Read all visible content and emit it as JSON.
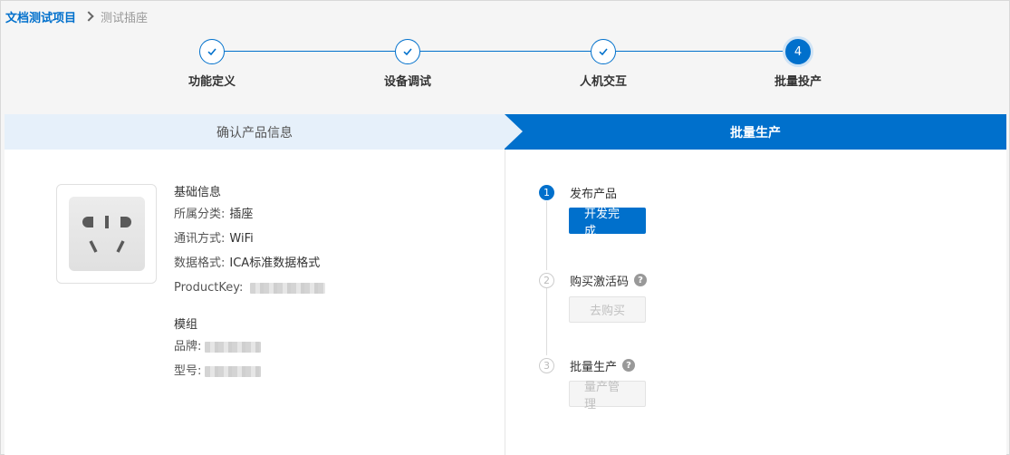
{
  "breadcrumb": {
    "root": "文档测试项目",
    "current": "测试插座"
  },
  "stepper": {
    "steps": [
      {
        "label": "功能定义",
        "state": "done"
      },
      {
        "label": "设备调试",
        "state": "done"
      },
      {
        "label": "人机交互",
        "state": "done"
      },
      {
        "label": "批量投产",
        "state": "active",
        "number": "4"
      }
    ]
  },
  "tabs": {
    "left": "确认产品信息",
    "right": "批量生产"
  },
  "product": {
    "image_icon": "smart-socket-icon",
    "basic_title": "基础信息",
    "category_label": "所属分类:",
    "category_value": "插座",
    "comm_label": "通讯方式:",
    "comm_value": "WiFi",
    "format_label": "数据格式:",
    "format_value": "ICA标准数据格式",
    "productkey_label": "ProductKey:",
    "module_title": "模组",
    "brand_label": "品牌:",
    "model_label": "型号:"
  },
  "production": {
    "steps": [
      {
        "number": "1",
        "title": "发布产品",
        "button": "开发完成",
        "has_help": false,
        "enabled": true
      },
      {
        "number": "2",
        "title": "购买激活码",
        "button": "去购买",
        "has_help": true,
        "enabled": false
      },
      {
        "number": "3",
        "title": "批量生产",
        "button": "量产管理",
        "has_help": true,
        "enabled": false
      }
    ],
    "help_glyph": "?"
  },
  "colors": {
    "accent": "#0070cc",
    "tab_light": "#e6f0fa",
    "disabled_text": "#c0c0c0"
  }
}
